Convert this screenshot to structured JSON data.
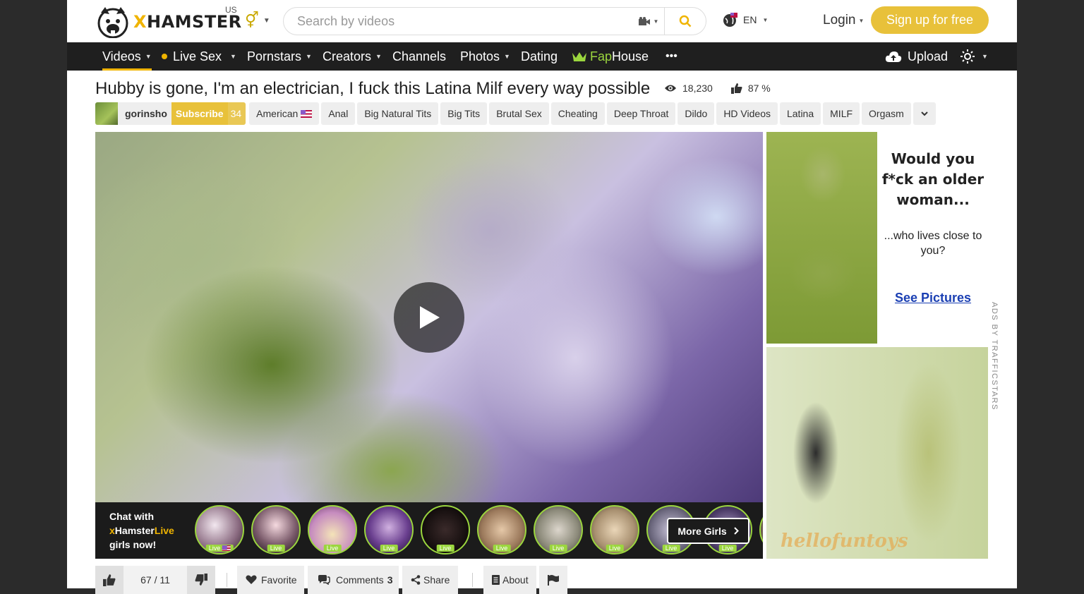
{
  "header": {
    "logo_text": "XHAMSTER",
    "region": "US",
    "search_placeholder": "Search by videos",
    "language": "EN",
    "login_label": "Login",
    "signup_label": "Sign up for free"
  },
  "nav": {
    "items": [
      "Videos",
      "Live Sex",
      "Pornstars",
      "Creators",
      "Channels",
      "Photos",
      "Dating"
    ],
    "fap": "Fap",
    "house": "House",
    "more": "•••",
    "upload_label": "Upload"
  },
  "video": {
    "title": "Hubby is gone, I'm an electrician, I fuck this Latina Milf every way possible",
    "views": "18,230",
    "rating": "87 %",
    "author": "gorinsho",
    "subscribe_label": "Subscribe",
    "subscriber_count": "34",
    "tags": [
      "American",
      "Anal",
      "Big Natural Tits",
      "Big Tits",
      "Brutal Sex",
      "Cheating",
      "Deep Throat",
      "Dildo",
      "HD Videos",
      "Latina",
      "MILF",
      "Orgasm"
    ]
  },
  "live": {
    "chat_line1": "Chat with",
    "brand_x": "x",
    "brand_hamster": "Hamster",
    "brand_live": "Live",
    "chat_line3": "girls now!",
    "badge": "Live",
    "more_girls": "More Girls"
  },
  "ads": {
    "headline": "Would you f*ck an older woman...",
    "subline": "...who lives close to you?",
    "link": "See Pictures",
    "watermark": "hellofuntoys",
    "attribution": "ADS BY TRAFFICSTARS"
  },
  "controls": {
    "votes": "67 / 11",
    "favorite": "Favorite",
    "comments_label": "Comments",
    "comments_count": "3",
    "share": "Share",
    "about": "About"
  },
  "colors": {
    "accent": "#f0b400",
    "signup": "#e8c13a",
    "nav_bg": "#1f1f1f",
    "live_green": "#9bd63e"
  }
}
